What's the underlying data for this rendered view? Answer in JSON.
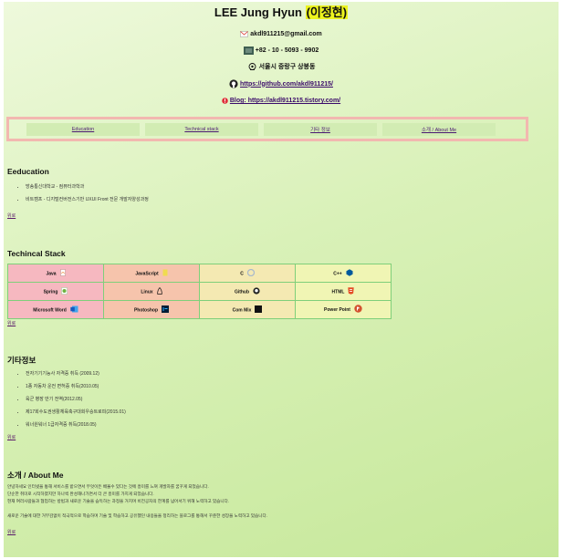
{
  "header": {
    "name_plain": "LEE Jung Hyun ",
    "name_korean": "(이정현)",
    "email": "akdl911215@gmail.com",
    "phone": "+82 - 10 - 5093 - 9902",
    "address": "서울시 중랑구 상봉동",
    "github": "https://github.com/akdl911215/",
    "blog": "Blog: https://akdl911215.tistory.com/"
  },
  "nav": [
    {
      "label": "Education"
    },
    {
      "label": "Technical stack"
    },
    {
      "label": "기타 정보"
    },
    {
      "label": "소개 / About Me"
    }
  ],
  "education": {
    "title": "Eeducation",
    "items": [
      "방송통신대학교 - 컴퓨터과학과",
      "비트캠프 - 디지털컨버전스기반 UXUI Front 전문 개발자양성과정"
    ],
    "top_link": "위로"
  },
  "stack": {
    "title": "Techincal Stack",
    "rows": [
      [
        {
          "label": "Java",
          "icon": "java-icon",
          "bg": "#f6b8c0"
        },
        {
          "label": "JavaScript",
          "icon": "js-icon",
          "bg": "#f6c4ac"
        },
        {
          "label": "C",
          "icon": "c-icon",
          "bg": "#f4e9b2"
        },
        {
          "label": "C++",
          "icon": "cpp-icon",
          "bg": "#f0f5b4"
        }
      ],
      [
        {
          "label": "Spring",
          "icon": "spring-icon",
          "bg": "#f6b8c0"
        },
        {
          "label": "Linux",
          "icon": "linux-icon",
          "bg": "#f6c4ac"
        },
        {
          "label": "Github",
          "icon": "github-icon",
          "bg": "#f4e9b2"
        },
        {
          "label": "HTML",
          "icon": "html-icon",
          "bg": "#f0f5b4"
        }
      ],
      [
        {
          "label": "Microsoft Word",
          "icon": "word-icon",
          "bg": "#f6b8c0"
        },
        {
          "label": "Photoshop",
          "icon": "photoshop-icon",
          "bg": "#f6c4ac"
        },
        {
          "label": "Com Mix",
          "icon": "commix-icon",
          "bg": "#f4e9b2"
        },
        {
          "label": "Power Point",
          "icon": "powerpoint-icon",
          "bg": "#f0f5b4"
        }
      ]
    ],
    "top_link": "위로"
  },
  "etc": {
    "title": "기타정보",
    "items": [
      "전자기기기능사 자격증 취득 (2009.12)",
      "1종 자동차 운전 면허증 취득(2010.05)",
      "육군 병장 만기 전역(2012.05)",
      "제17회수도권생활체육축구대회우승트로피(2015.01)",
      "워너원워너 1급자격증 취득(2018.05)"
    ],
    "top_link": "위로"
  },
  "about": {
    "title": "소개 / About Me",
    "lines": [
      "안녕하세요 인터넷을 통해 서비스를 받으면서 무엇이든 배울수 있다는 것에 흥미를 느껴 개발자를 꿈꾸게 되었습니다.",
      "단순한 취미로 시작하였지만 하나씩 완성해나가면서 더 큰 흥미를 가지게 되었습니다.",
      "현재 여러사람들과 협업하는 방법과 새로운 기술을 습득하는 과정을 거치며 비전공자의 한계를 넘어서기 위해 노력하고 있습니다.",
      "",
      "새로운 기술에 대한 거부감없이 적극적으로 학습하며 기술 및 학습하고 공유했던 내용들을 정리하는 블로그를 통해서 꾸준한 성장을 노력하고 있습니다."
    ],
    "top_link": "위로"
  },
  "colors": {
    "accent_highlight": "#ecf31e",
    "nav_border": "#f2b8b0",
    "nav_button": "#d2ecb3",
    "link": "#3a0a6a",
    "table_border": "#7fcf7a"
  }
}
